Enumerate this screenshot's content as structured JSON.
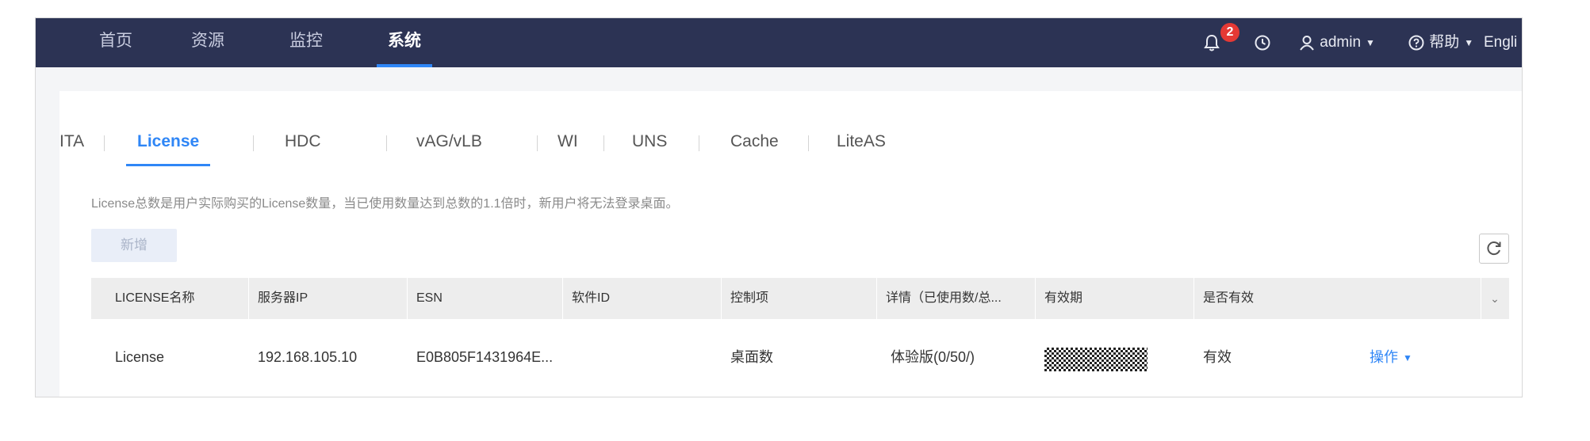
{
  "nav": {
    "items": [
      "首页",
      "资源",
      "监控",
      "系统"
    ],
    "active_index": 3,
    "notification_count": "2",
    "user": "admin",
    "help": "帮助",
    "language": "Engli"
  },
  "tabs": {
    "items": [
      "ITA",
      "License",
      "HDC",
      "vAG/vLB",
      "WI",
      "UNS",
      "Cache",
      "LiteAS"
    ],
    "active": "License"
  },
  "notice": "License总数是用户实际购买的License数量，当已使用数量达到总数的1.1倍时，新用户将无法登录桌面。",
  "toolbar": {
    "add_label": "新增"
  },
  "table": {
    "columns": [
      "LICENSE名称",
      "服务器IP",
      "ESN",
      "软件ID",
      "控制项",
      "详情（已使用数/总...",
      "有效期",
      "是否有效"
    ],
    "rows": [
      {
        "name": "License",
        "server_ip": "192.168.105.10",
        "esn": "E0B805F1431964E...",
        "software_id": "",
        "control": "桌面数",
        "details": "体验版(0/50/)",
        "validity": "",
        "valid": "有效",
        "action": "操作"
      }
    ]
  },
  "colors": {
    "nav_bg": "#2c3354",
    "accent": "#2f86f6",
    "badge": "#e53935"
  }
}
